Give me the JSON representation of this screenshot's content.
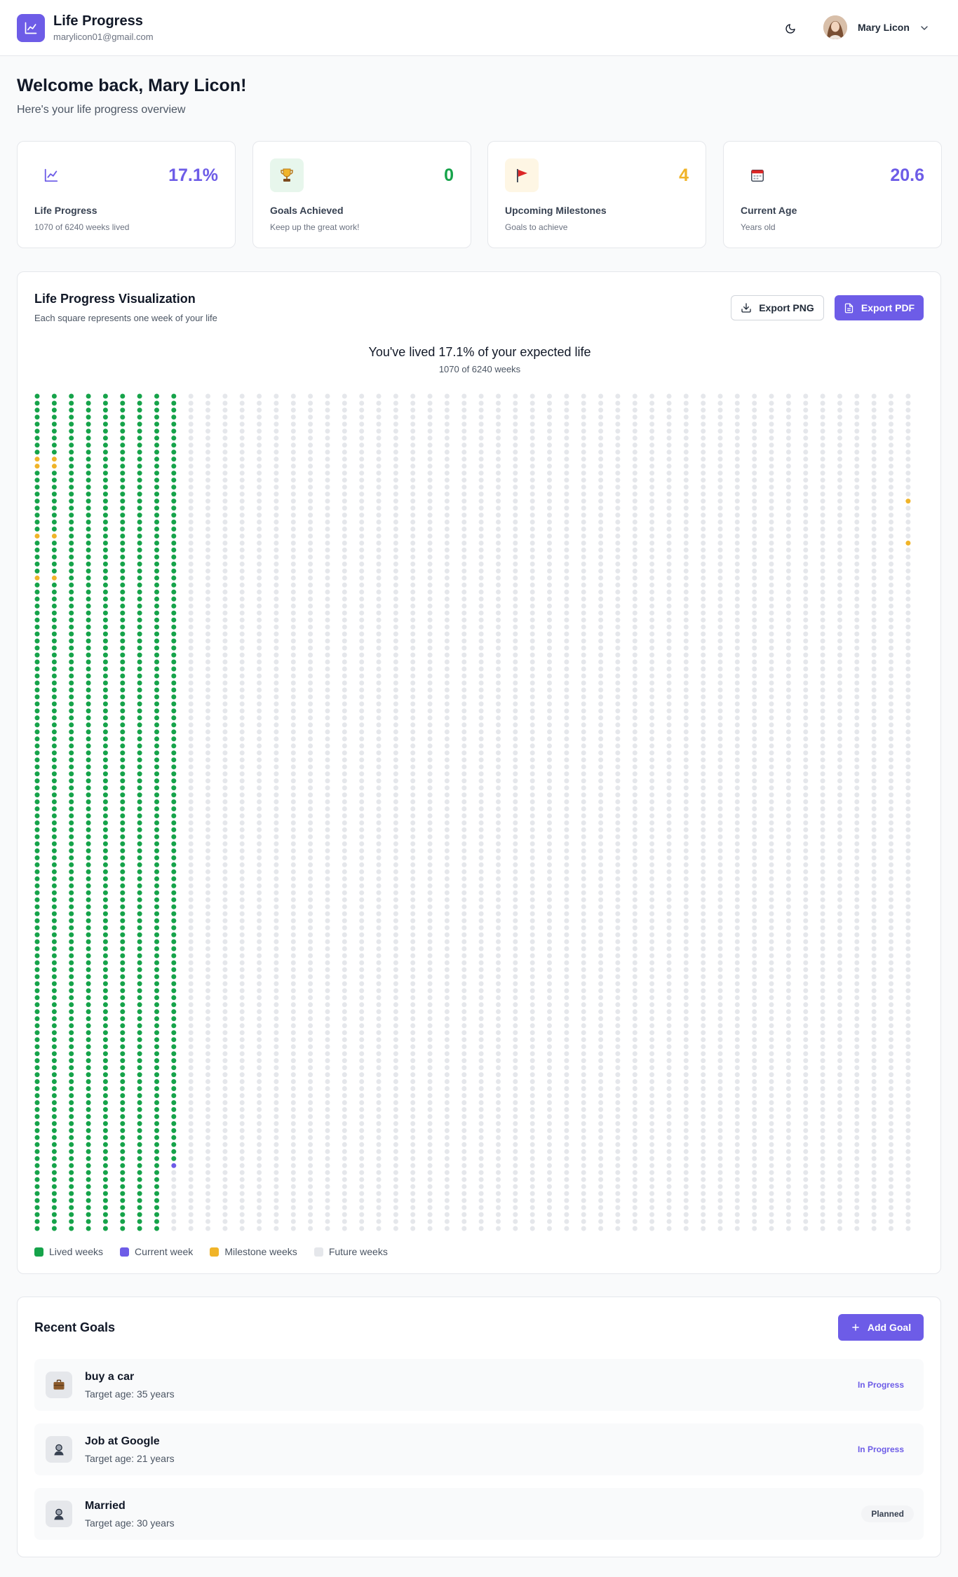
{
  "header": {
    "title": "Life Progress",
    "email": "marylicon01@gmail.com",
    "user_name": "Mary Licon"
  },
  "welcome": {
    "title": "Welcome back, Mary Licon!",
    "subtitle": "Here's your life progress overview"
  },
  "stats": [
    {
      "value": "17.1%",
      "label": "Life Progress",
      "sub": "1070 of 6240 weeks lived",
      "icon": "chart-line-icon",
      "color": "#6d5ce7"
    },
    {
      "value": "0",
      "label": "Goals Achieved",
      "sub": "Keep up the great work!",
      "icon": "trophy-icon",
      "color": "#16a34a"
    },
    {
      "value": "4",
      "label": "Upcoming Milestones",
      "sub": "Goals to achieve",
      "icon": "flag-icon",
      "color": "#f0b429"
    },
    {
      "value": "20.6",
      "label": "Current Age",
      "sub": "Years old",
      "icon": "calendar-icon",
      "color": "#6d5ce7"
    }
  ],
  "viz": {
    "title": "Life Progress Visualization",
    "subtitle": "Each square represents one week of your life",
    "export_png": "Export PNG",
    "export_pdf": "Export PDF",
    "heading": "You've lived 17.1% of your expected life",
    "count": "1070 of 6240 weeks",
    "weeks_total": 6240,
    "weeks_lived": 1070,
    "weeks_per_column": 120,
    "milestone_weeks": [
      9,
      10,
      20,
      26,
      129,
      130,
      140,
      146,
      6135,
      6141
    ],
    "colors": {
      "lived": "#16a34a",
      "current": "#6d5ce7",
      "milestone": "#f0b429",
      "future": "#e5e7eb"
    },
    "legend": [
      {
        "label": "Lived weeks",
        "color": "#16a34a"
      },
      {
        "label": "Current week",
        "color": "#6d5ce7"
      },
      {
        "label": "Milestone weeks",
        "color": "#f0b429"
      },
      {
        "label": "Future weeks",
        "color": "#e5e7eb"
      }
    ]
  },
  "goals": {
    "title": "Recent Goals",
    "add_label": "Add Goal",
    "items": [
      {
        "name": "buy a car",
        "target": "Target age: 35 years",
        "status": "In Progress",
        "icon": "briefcase-icon"
      },
      {
        "name": "Job at Google",
        "target": "Target age: 21 years",
        "status": "In Progress",
        "icon": "person-icon"
      },
      {
        "name": "Married",
        "target": "Target age: 30 years",
        "status": "Planned",
        "icon": "person-icon"
      }
    ]
  }
}
